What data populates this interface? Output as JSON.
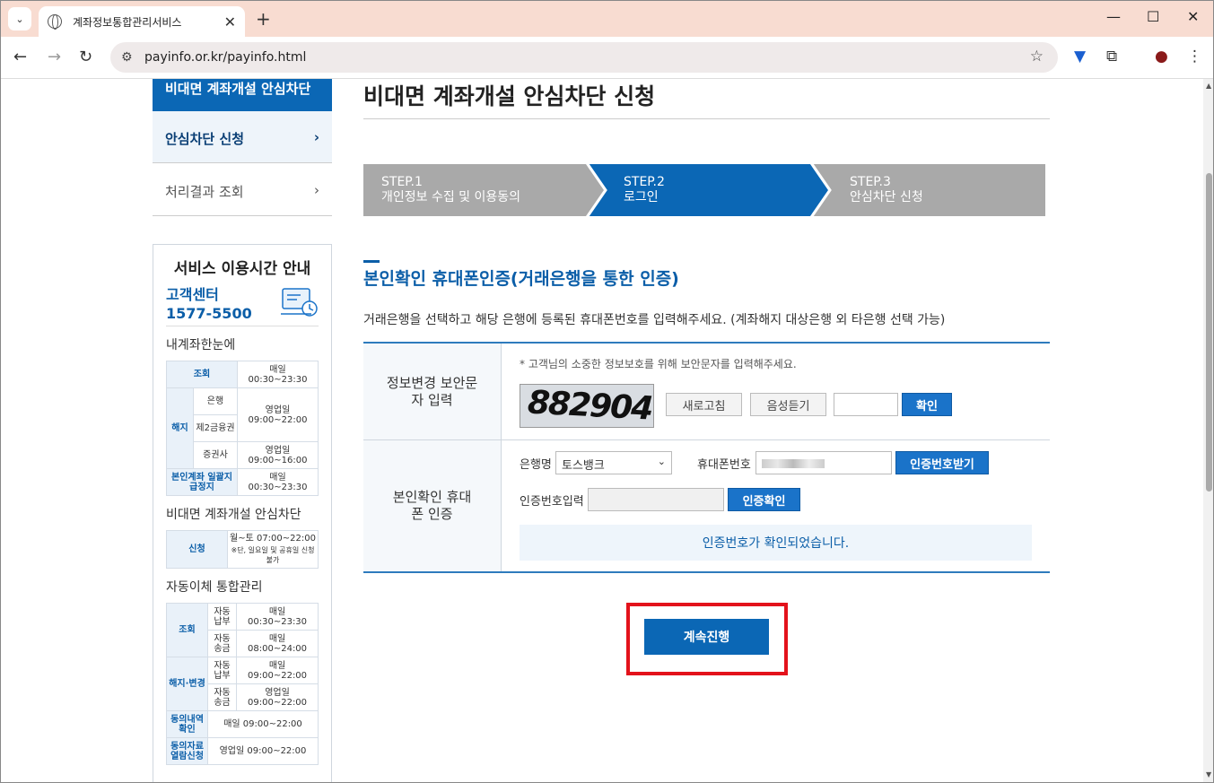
{
  "browser": {
    "tab_title": "계좌정보통합관리서비스",
    "url": "payinfo.or.kr/payinfo.html"
  },
  "sidebar": {
    "header": "비대면 계좌개설 안심차단",
    "items": [
      {
        "label": "안심차단 신청"
      },
      {
        "label": "처리결과 조회"
      }
    ],
    "service": {
      "title": "서비스 이용시간 안내",
      "cc_label": "고객센터",
      "cc_phone": "1577-5500",
      "sec1_title": "내계좌한눈에",
      "t1": {
        "inquiry": "조회",
        "inquiry_time": "매일 00:30~23:30",
        "cancel": "해지",
        "bank": "은행",
        "sec2": "제2금융권",
        "stock": "증권사",
        "bank_time": "영업일 09:00~22:00",
        "stock_time": "영업일 09:00~16:00",
        "stop": "본인계좌 일괄지급정지",
        "stop_time": "매일 00:30~23:30"
      },
      "sec2_title": "비대면 계좌개설 안심차단",
      "t2": {
        "apply": "신청",
        "time": "월~토 07:00~22:00",
        "note": "※단, 일요일 및 공휴일 신청 불가"
      },
      "sec3_title": "자동이체 통합관리",
      "t3": {
        "inquiry": "조회",
        "auto_pay": "자동납부",
        "auto_send": "자동송금",
        "inq_pay_time": "매일 00:30~23:30",
        "inq_send_time": "매일 08:00~24:00",
        "change": "해지·변경",
        "chg_pay_time": "매일 09:00~22:00",
        "chg_send_time": "영업일 09:00~22:00",
        "consent": "동의내역 확인",
        "consent_time": "매일 09:00~22:00",
        "material": "동의자료 열람신청",
        "material_time": "영업일 09:00~22:00"
      }
    }
  },
  "main": {
    "title": "비대면 계좌개설 안심차단 신청",
    "steps": [
      {
        "num": "STEP.1",
        "label": "개인정보 수집 및 이용동의",
        "active": false
      },
      {
        "num": "STEP.2",
        "label": "로그인",
        "active": true
      },
      {
        "num": "STEP.3",
        "label": "안심차단 신청",
        "active": false
      }
    ],
    "section_title": "본인확인 휴대폰인증(거래은행을 통한 인증)",
    "description": "거래은행을 선택하고 해당 은행에 등록된 휴대폰번호를 입력해주세요. (계좌해지 대상은행 외 타은행 선택 가능)",
    "captcha": {
      "label": "정보변경 보안문자 입력",
      "notice": "* 고객님의 소중한 정보보호를 위해 보안문자를 입력해주세요.",
      "image_text": "882904",
      "refresh": "새로고침",
      "audio": "음성듣기",
      "confirm": "확인"
    },
    "phone": {
      "label": "본인확인 휴대폰 인증",
      "bank_label": "은행명",
      "bank_value": "토스뱅크",
      "phone_label": "휴대폰번호",
      "request_btn": "인증번호받기",
      "code_label": "인증번호입력",
      "verify_btn": "인증확인",
      "status": "인증번호가 확인되었습니다."
    },
    "continue_btn": "계속진행"
  },
  "colors": {
    "primary": "#0b67b5",
    "step_inactive": "#a9a9a9",
    "highlight": "#e3121b"
  }
}
